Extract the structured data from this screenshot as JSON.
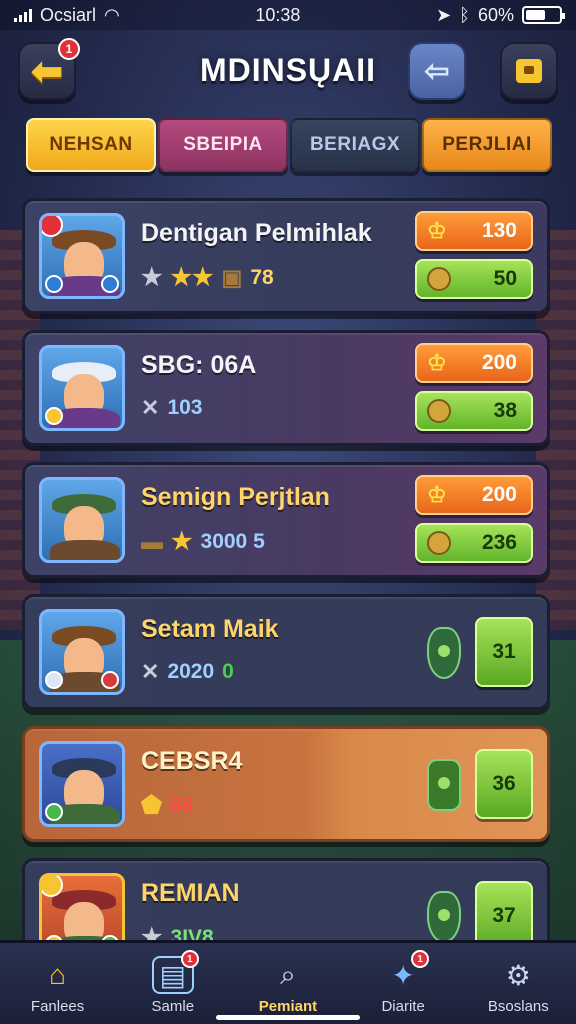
{
  "status_bar": {
    "carrier": "Ocsiarl",
    "time": "10:38",
    "battery": "60%",
    "battery_level": 0.6
  },
  "header": {
    "title": "MDINSŲAII",
    "back_badge": "1"
  },
  "tabs": [
    {
      "label": "NEHSAN"
    },
    {
      "label": "SBEIPIA"
    },
    {
      "label": "BERIAGX"
    },
    {
      "label": "PERJLIAI"
    }
  ],
  "players": [
    {
      "name": "Dentigan Pelmihlak",
      "stat": "78",
      "score": "130",
      "value": "50"
    },
    {
      "name": "SBG: 06A",
      "stat": "103",
      "score": "200",
      "value": "38"
    },
    {
      "name": "Semign Perjtlan",
      "stat": "3000 5",
      "score": "200",
      "value": "236"
    },
    {
      "name": "Setam Maik",
      "stat": "2020",
      "extra": "0",
      "value": "31"
    },
    {
      "name": "CEBSR4",
      "stat": "68",
      "value": "36"
    },
    {
      "name": "REMIAN",
      "stat": "3IV8",
      "value": "37"
    }
  ],
  "nav": [
    {
      "label": "Fanlees",
      "icon": "home-icon"
    },
    {
      "label": "Samle",
      "icon": "card-icon",
      "badge": "1"
    },
    {
      "label": "Pemiant",
      "icon": "search-icon"
    },
    {
      "label": "Diarite",
      "icon": "star-card-icon",
      "badge": "1"
    },
    {
      "label": "Bsoslans",
      "icon": "gear-icon"
    }
  ],
  "colors": {
    "accent_gold": "#f6c531",
    "orange_pill": "#ff9b3a",
    "green_pill": "#a6e35a",
    "bg": "#232a4d"
  }
}
